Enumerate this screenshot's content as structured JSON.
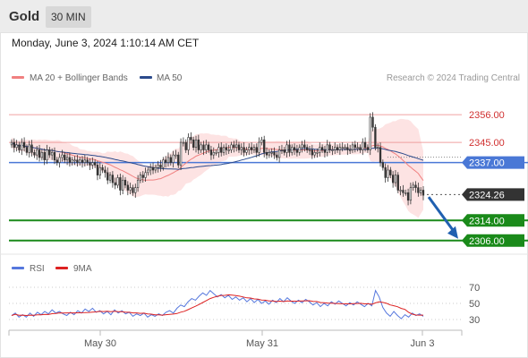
{
  "header": {
    "title": "Gold",
    "timeframe": "30 MIN"
  },
  "datetime": "Monday, June 3, 2024 1:10:14 AM CET",
  "legend": {
    "bollinger_label": "MA 20 + Bollinger Bands",
    "ma50_label": "MA 50",
    "copyright": "Research © 2024 Trading Central"
  },
  "colors": {
    "bollinger": "#f08080",
    "band_fill": "#fde0e0",
    "ma50": "#2b4a8c",
    "level_line": "#f0a0a0",
    "current_level": "#4a78d6",
    "target_level": "#1a8a1a",
    "price_tag": "#333333",
    "rsi": "#5577dd",
    "rsi_ma": "#dd2222",
    "candle_up": "#ffffff",
    "candle_down": "#333333",
    "arrow": "#2060b0"
  },
  "chart_data": [
    {
      "type": "candlestick",
      "title": "Gold",
      "x_tick_labels": [
        "May 30",
        "May 31",
        "Jun 3"
      ],
      "price_levels": [
        {
          "label": "2356.00",
          "value": 2356.0,
          "style": "resistance"
        },
        {
          "label": "2345.00",
          "value": 2345.0,
          "style": "resistance"
        },
        {
          "label": "2337.00",
          "value": 2337.0,
          "style": "pivot"
        },
        {
          "label": "2324.26",
          "value": 2324.26,
          "style": "last_price"
        },
        {
          "label": "2314.00",
          "value": 2314.0,
          "style": "target"
        },
        {
          "label": "2306.00",
          "value": 2306.0,
          "style": "target"
        }
      ],
      "ylim": [
        2302,
        2366
      ],
      "close": [
        2345,
        2343,
        2344,
        2342,
        2345,
        2343,
        2341,
        2344,
        2341,
        2340,
        2342,
        2339,
        2341,
        2338,
        2342,
        2340,
        2341,
        2338,
        2337,
        2339,
        2340,
        2338,
        2339,
        2337,
        2338,
        2338,
        2337,
        2338,
        2337,
        2338,
        2337,
        2336,
        2337,
        2336,
        2332,
        2335,
        2334,
        2333,
        2330,
        2332,
        2329,
        2328,
        2331,
        2326,
        2330,
        2328,
        2326,
        2327,
        2325,
        2327,
        2330,
        2332,
        2331,
        2333,
        2334,
        2335,
        2334,
        2335,
        2336,
        2335,
        2338,
        2337,
        2339,
        2337,
        2340,
        2340,
        2336,
        2345,
        2345,
        2342,
        2347,
        2346,
        2343,
        2346,
        2342,
        2344,
        2342,
        2344,
        2342,
        2340,
        2341,
        2341,
        2343,
        2341,
        2343,
        2342,
        2342,
        2344,
        2343,
        2344,
        2342,
        2343,
        2341,
        2342,
        2343,
        2342,
        2343,
        2341,
        2345,
        2346,
        2341,
        2340,
        2341,
        2341,
        2340,
        2339,
        2342,
        2342,
        2341,
        2344,
        2341,
        2343,
        2342,
        2341,
        2343,
        2344,
        2343,
        2342,
        2342,
        2340,
        2341,
        2341,
        2343,
        2342,
        2341,
        2344,
        2342,
        2342,
        2343,
        2342,
        2343,
        2343,
        2343,
        2342,
        2342,
        2344,
        2343,
        2343,
        2342,
        2345,
        2343,
        2342,
        2355,
        2351,
        2343,
        2343,
        2337,
        2335,
        2331,
        2334,
        2332,
        2329,
        2332,
        2326,
        2326,
        2325,
        2325,
        2322,
        2327,
        2328,
        2327,
        2325,
        2326,
        2324
      ],
      "rsi": {
        "label": "RSI",
        "ma_label": "9MA",
        "levels": [
          70,
          50,
          30
        ],
        "ylim": [
          20,
          80
        ],
        "values": [
          35,
          38,
          33,
          36,
          33,
          38,
          34,
          39,
          36,
          40,
          37,
          42,
          38,
          40,
          37,
          35,
          39,
          36,
          41,
          38,
          43,
          40,
          44,
          39,
          41,
          37,
          40,
          36,
          42,
          38,
          41,
          37,
          39,
          34,
          37,
          35,
          38,
          33,
          36,
          34,
          37,
          35,
          39,
          41,
          38,
          44,
          48,
          46,
          52,
          56,
          54,
          59,
          63,
          60,
          66,
          62,
          58,
          61,
          57,
          60,
          55,
          58,
          54,
          57,
          52,
          56,
          51,
          55,
          50,
          53,
          49,
          54,
          51,
          56,
          52,
          57,
          53,
          50,
          54,
          51,
          55,
          52,
          48,
          51,
          46,
          50,
          47,
          52,
          49,
          53,
          50,
          47,
          51,
          48,
          52,
          49,
          46,
          50,
          47,
          66,
          58,
          45,
          38,
          34,
          40,
          35,
          31,
          36,
          33,
          38,
          35,
          37,
          34
        ]
      }
    }
  ]
}
